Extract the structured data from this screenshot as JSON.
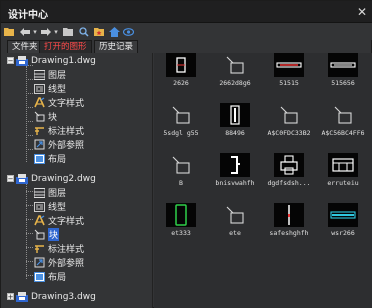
{
  "window": {
    "title": "设计中心",
    "close_label": "✕"
  },
  "toolbar": {
    "buttons": [
      {
        "name": "folder-icon",
        "glyph": "■"
      },
      {
        "name": "back-arrow-icon",
        "glyph": "←"
      },
      {
        "name": "dropdown-icon",
        "glyph": "▾"
      },
      {
        "name": "forward-arrow-icon",
        "glyph": "→"
      },
      {
        "name": "dropdown-icon",
        "glyph": "▾"
      },
      {
        "name": "up-folder-icon",
        "glyph": "■"
      },
      {
        "name": "search-icon",
        "glyph": "⌕"
      },
      {
        "name": "favorites-icon",
        "glyph": "■"
      },
      {
        "name": "home-icon",
        "glyph": "⌂"
      },
      {
        "name": "tree-toggle-icon",
        "glyph": "◉"
      }
    ]
  },
  "tabs": [
    {
      "label": "文件夹",
      "active": false
    },
    {
      "label": "打开的图形",
      "active": true
    },
    {
      "label": "历史记录",
      "active": false
    }
  ],
  "tree": {
    "drawings": [
      {
        "label": "Drawing1.dwg",
        "expanded": true,
        "children": [
          "图层",
          "线型",
          "文字样式",
          "块",
          "标注样式",
          "外部参照",
          "布局"
        ]
      },
      {
        "label": "Drawing2.dwg",
        "expanded": true,
        "children": [
          "图层",
          "线型",
          "文字样式",
          "块",
          "标注样式",
          "外部参照",
          "布局"
        ],
        "selected_child": "块"
      },
      {
        "label": "Drawing3.dwg",
        "expanded": false,
        "children": []
      }
    ]
  },
  "blocks": [
    {
      "label": "2626",
      "thumb": "rect-white-dark"
    },
    {
      "label": "2662d8g6",
      "thumb": "block-icon"
    },
    {
      "label": "51515",
      "thumb": "red-bar-dark"
    },
    {
      "label": "515656",
      "thumb": "white-bar-dark"
    },
    {
      "label": "5sdgl g55",
      "thumb": "block-icon"
    },
    {
      "label": "88496",
      "thumb": "door-dark"
    },
    {
      "label": "A$C0FDC33B2",
      "thumb": "block-icon"
    },
    {
      "label": "A$C56BC4FF6",
      "thumb": "block-icon"
    },
    {
      "label": "B",
      "thumb": "block-icon"
    },
    {
      "label": "bnisvwahfh",
      "thumb": "bracket-dark"
    },
    {
      "label": "dgdfsdsh...",
      "thumb": "printer-dark"
    },
    {
      "label": "erruteiu",
      "thumb": "cabinet-dark"
    },
    {
      "label": "et333",
      "thumb": "green-rect-dark"
    },
    {
      "label": "ete",
      "thumb": "block-icon"
    },
    {
      "label": "safeshghfh",
      "thumb": "vline-dark"
    },
    {
      "label": "wsr266",
      "thumb": "cyan-bar-dark"
    }
  ],
  "colors": {
    "accent_tab": "#ff4a4a",
    "selection": "#2f66d0",
    "panel": "#333436"
  }
}
